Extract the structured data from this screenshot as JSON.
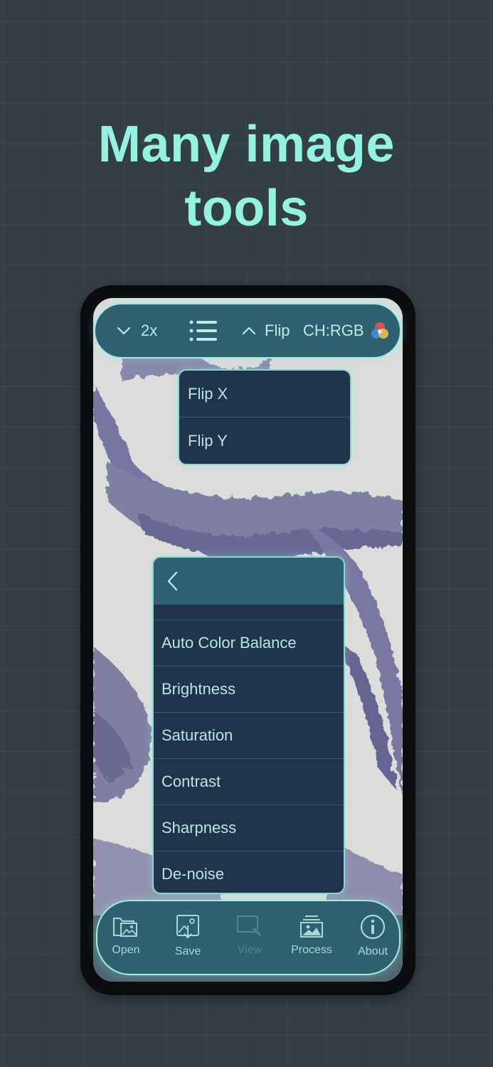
{
  "headline": {
    "line1": "Many image",
    "line2": "tools"
  },
  "toolbar": {
    "zoom_label": "2x",
    "flip_label": "Flip",
    "channel_label": "CH:RGB",
    "icons": [
      "chevron-down-icon",
      "list-icon",
      "chevron-up-icon",
      "color-channels-icon"
    ]
  },
  "flip_menu": {
    "items": [
      "Flip X",
      "Flip Y"
    ]
  },
  "process_menu": {
    "back_icon": "chevron-left-icon",
    "items": [
      "Auto Color Balance",
      "Brightness",
      "Saturation",
      "Contrast",
      "Sharpness",
      "De-noise"
    ]
  },
  "bottom_bar": {
    "items": [
      {
        "label": "Open",
        "icon": "open-folder-icon"
      },
      {
        "label": "Save",
        "icon": "save-image-icon"
      },
      {
        "label": "View",
        "icon": "view-icon",
        "disabled": true
      },
      {
        "label": "Process",
        "icon": "process-image-icon"
      },
      {
        "label": "About",
        "icon": "info-icon"
      }
    ]
  },
  "colors": {
    "background": "#343f44",
    "accent": "#93f2e1",
    "toolbar": "#2e6070",
    "menu": "#20344b",
    "menu_text": "#b7e6e3"
  }
}
